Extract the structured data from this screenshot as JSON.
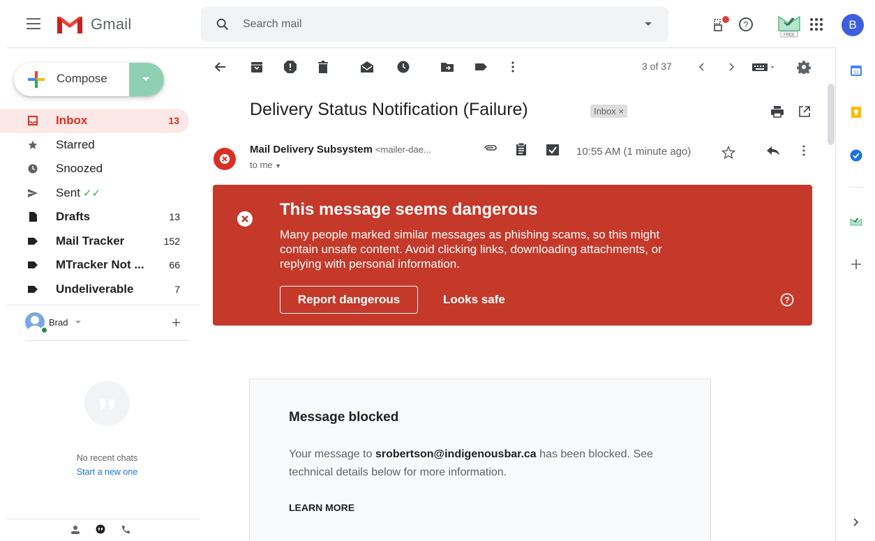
{
  "app": {
    "name": "Gmail"
  },
  "search": {
    "placeholder": "Search mail"
  },
  "user": {
    "initial": "B"
  },
  "compose": {
    "label": "Compose"
  },
  "nav": [
    {
      "label": "Inbox",
      "count": "13",
      "icon": "inbox-icon",
      "bold": true,
      "active": true
    },
    {
      "label": "Starred",
      "count": "",
      "icon": "star-icon",
      "bold": false
    },
    {
      "label": "Snoozed",
      "count": "",
      "icon": "clock-icon",
      "bold": false
    },
    {
      "label": "Sent",
      "count": "",
      "icon": "send-icon",
      "bold": false,
      "suffix": "✓✓"
    },
    {
      "label": "Drafts",
      "count": "13",
      "icon": "draft-icon",
      "bold": true
    },
    {
      "label": "Mail Tracker",
      "count": "152",
      "icon": "label-icon",
      "bold": true
    },
    {
      "label": "MTracker Not ...",
      "count": "66",
      "icon": "label-icon",
      "bold": true
    },
    {
      "label": "Undeliverable",
      "count": "7",
      "icon": "label-icon",
      "bold": true
    }
  ],
  "hangouts": {
    "user": "Brad",
    "empty_text": "No recent chats",
    "start_link": "Start a new one"
  },
  "toolbar": {
    "pager": "3 of 37"
  },
  "email": {
    "subject": "Delivery Status Notification (Failure)",
    "label_chip": "Inbox ×",
    "sender_name": "Mail Delivery Subsystem",
    "sender_email": "<mailer-dae...",
    "recipient": "to me",
    "time": "10:55 AM (1 minute ago)"
  },
  "warning": {
    "title": "This message seems dangerous",
    "body": "Many people marked similar messages as phishing scams, so this might contain unsafe content. Avoid clicking links, downloading attachments, or replying with personal information.",
    "report_button": "Report dangerous",
    "safe_button": "Looks safe",
    "color": "#c5392a"
  },
  "card": {
    "title": "Message blocked",
    "body_prefix": "Your message to ",
    "body_email": "srobertson@indigenousbar.ca",
    "body_suffix": " has been blocked. See technical details below for more information.",
    "link": "LEARN MORE"
  },
  "colors": {
    "accent_red": "#d93025",
    "link_blue": "#1a73e8",
    "compose_drop": "#8fd0b3"
  }
}
